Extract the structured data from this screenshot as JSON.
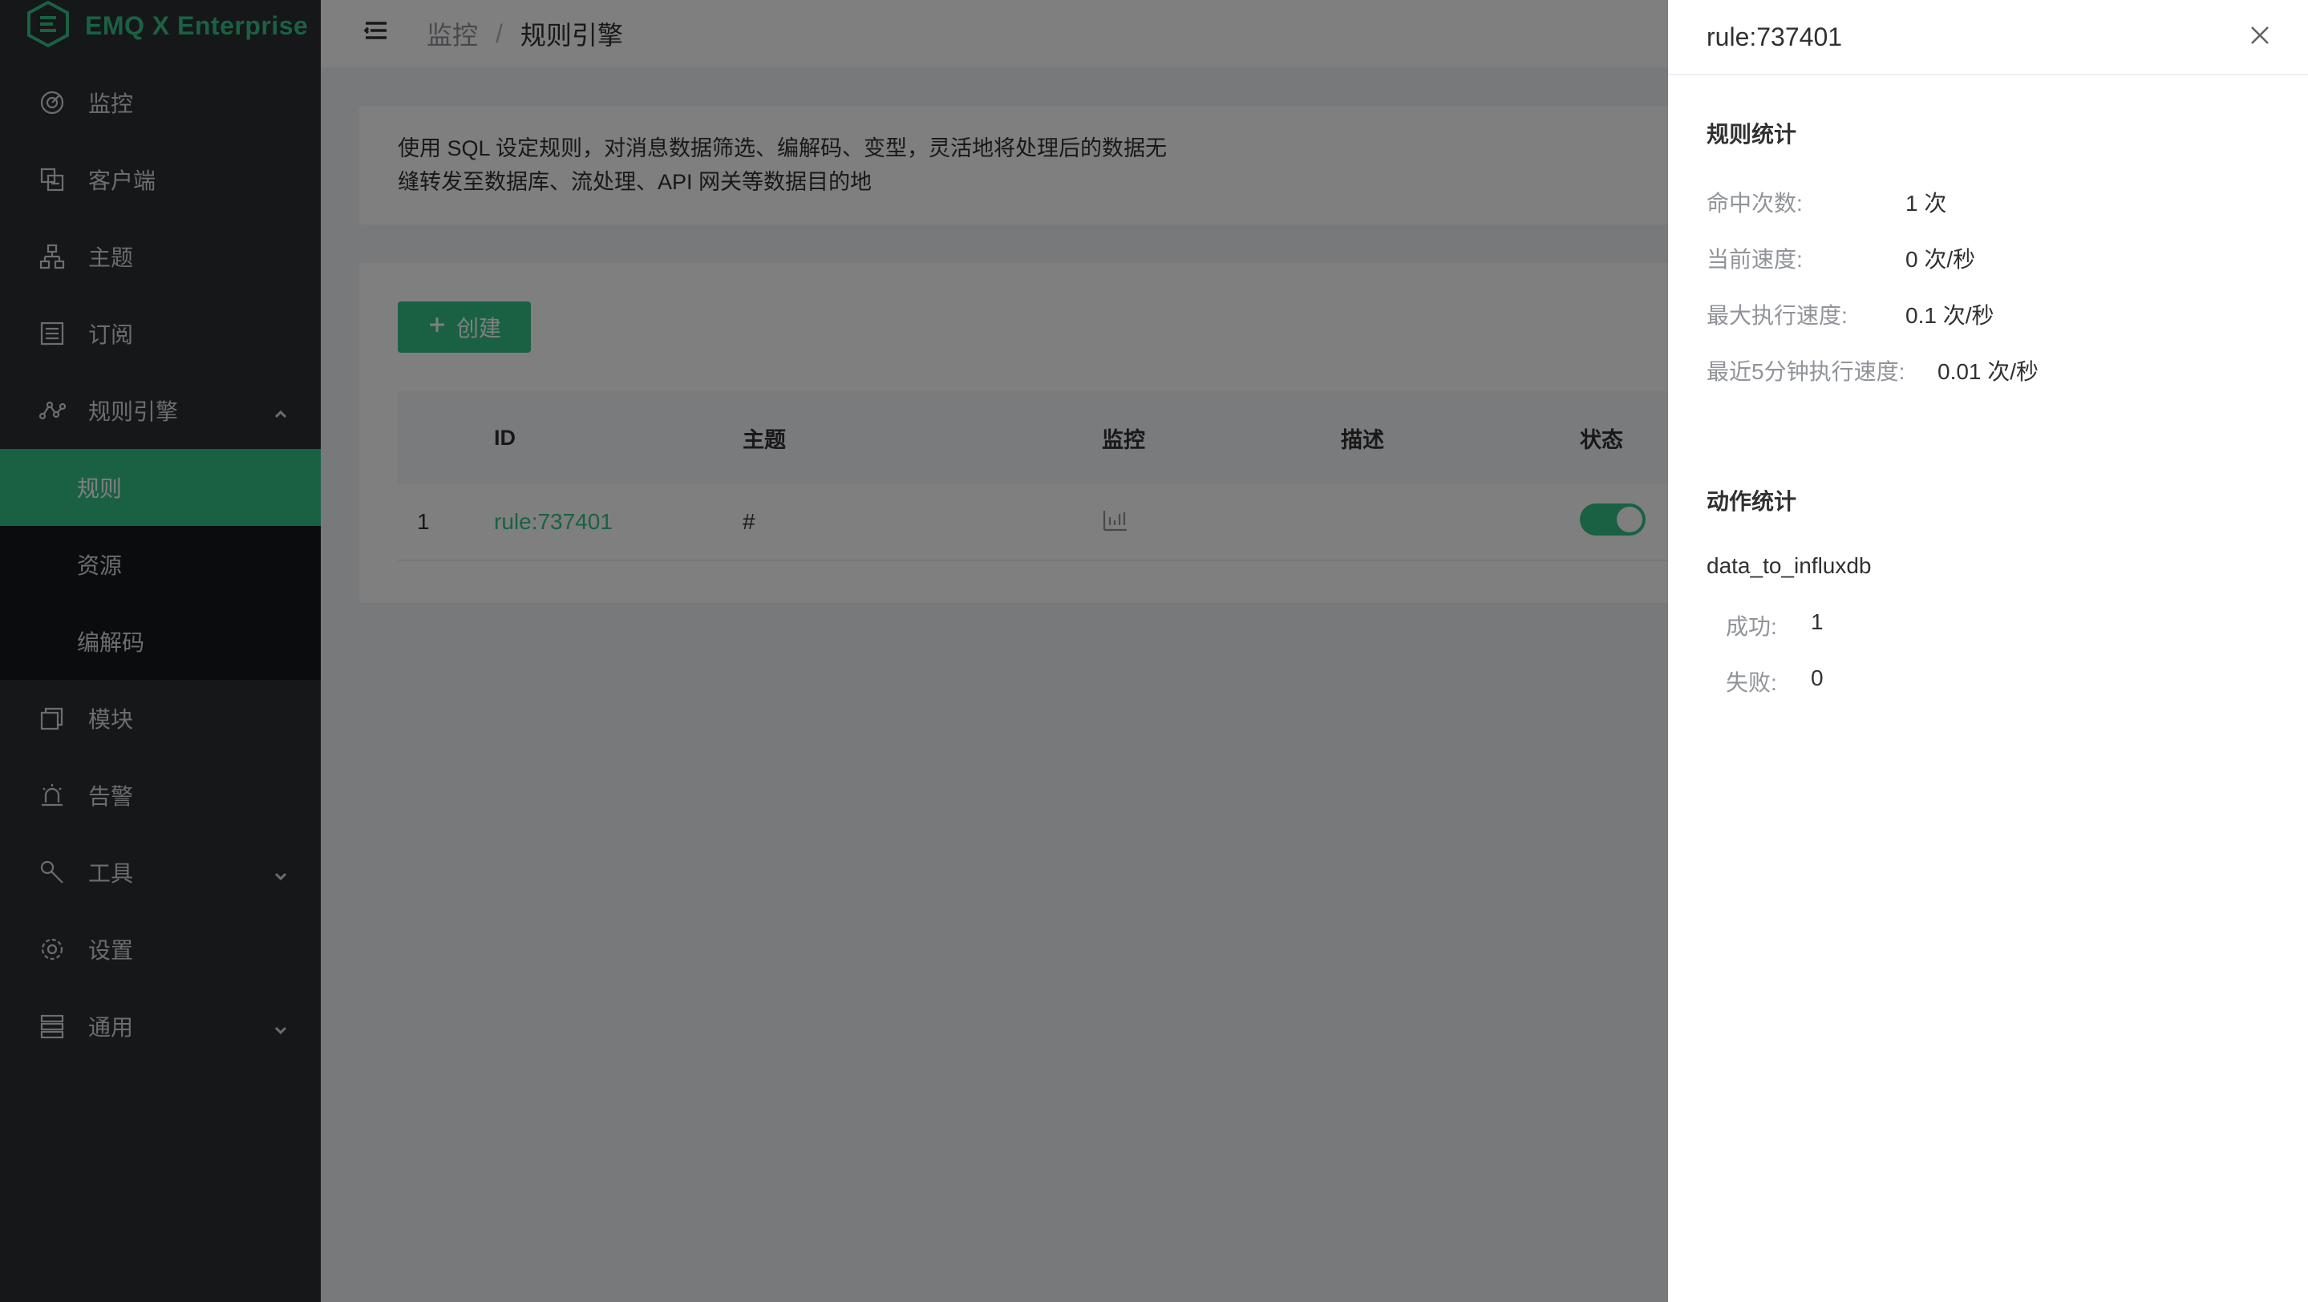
{
  "app": {
    "brand": "EMQ X Enterprise"
  },
  "sidebar": {
    "items": [
      {
        "label": "监控",
        "icon": "monitor-icon"
      },
      {
        "label": "客户端",
        "icon": "clients-icon"
      },
      {
        "label": "主题",
        "icon": "topics-icon"
      },
      {
        "label": "订阅",
        "icon": "subscriptions-icon"
      },
      {
        "label": "规则引擎",
        "icon": "rule-engine-icon"
      },
      {
        "label": "模块",
        "icon": "modules-icon"
      },
      {
        "label": "告警",
        "icon": "alarm-icon"
      },
      {
        "label": "工具",
        "icon": "tools-icon"
      },
      {
        "label": "设置",
        "icon": "settings-icon"
      },
      {
        "label": "通用",
        "icon": "general-icon"
      }
    ],
    "rule_engine_sub": [
      {
        "label": "规则",
        "active": true
      },
      {
        "label": "资源"
      },
      {
        "label": "编解码"
      }
    ]
  },
  "breadcrumb": {
    "parent": "监控",
    "separator": "/",
    "current": "规则引擎"
  },
  "description": {
    "line1": "使用 SQL 设定规则，对消息数据筛选、编解码、变型，灵活地将处理后的数据无",
    "line2": "缝转发至数据库、流处理、API 网关等数据目的地"
  },
  "toolbar": {
    "create_label": "创建"
  },
  "table": {
    "headers": {
      "id": "ID",
      "topic": "主题",
      "monitor": "监控",
      "desc": "描述",
      "status": "状态"
    },
    "rows": [
      {
        "index": "1",
        "id": "rule:737401",
        "topic": "#",
        "desc": "",
        "enabled": true
      }
    ]
  },
  "drawer": {
    "title": "rule:737401",
    "rule_stats_title": "规则统计",
    "rule_stats": [
      {
        "label": "命中次数:",
        "value": "1 次"
      },
      {
        "label": "当前速度:",
        "value": "0 次/秒"
      },
      {
        "label": "最大执行速度:",
        "value": "0.1 次/秒"
      },
      {
        "label": "最近5分钟执行速度:",
        "value": "0.01 次/秒"
      }
    ],
    "action_stats_title": "动作统计",
    "action": {
      "name": "data_to_influxdb",
      "success_label": "成功:",
      "success_value": "1",
      "fail_label": "失败:",
      "fail_value": "0"
    }
  },
  "colors": {
    "accent": "#34c388",
    "sidebar_bg": "#2a2e33",
    "submenu_bg": "#15181b"
  }
}
